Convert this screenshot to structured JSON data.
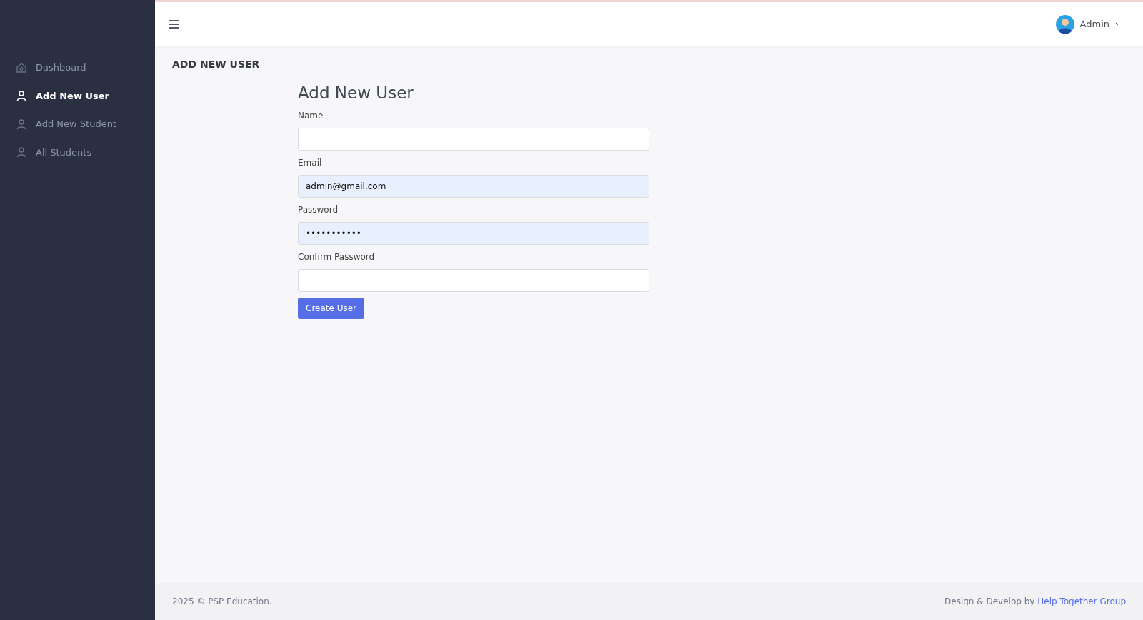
{
  "sidebar": {
    "items": [
      {
        "label": "Dashboard",
        "kind": "home",
        "selected": false
      },
      {
        "label": "Add New User",
        "kind": "user",
        "selected": true
      },
      {
        "label": "Add New Student",
        "kind": "user",
        "selected": false
      },
      {
        "label": "All Students",
        "kind": "user",
        "selected": false
      }
    ]
  },
  "topbar": {
    "user": "Admin"
  },
  "page_title": "ADD NEW USER",
  "form": {
    "heading": "Add New User",
    "fields": [
      {
        "label": "Name",
        "autofilled": false
      },
      {
        "label": "Email",
        "value": "admin@gmail.com",
        "autofilled": true
      },
      {
        "label": "Password",
        "value": "•••••••••••",
        "autofilled": true
      },
      {
        "label": "Confirm Password",
        "autofilled": false
      }
    ],
    "submit": "Create User"
  },
  "footer": {
    "copyright": "2025 © PSP Education.",
    "credit": "Design & Develop by",
    "credit_link": "Help Together Group"
  }
}
